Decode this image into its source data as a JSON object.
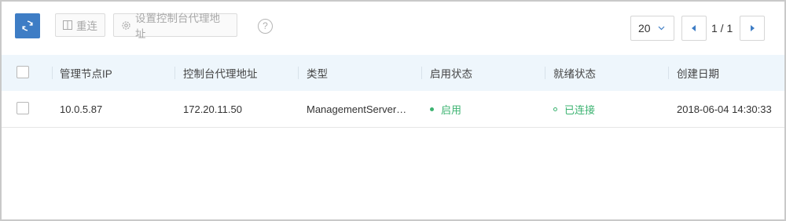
{
  "toolbar": {
    "refresh_icon": "refresh-icon",
    "reconnect_label": "重连",
    "set_proxy_label": "设置控制台代理地址",
    "help_glyph": "?"
  },
  "pagination": {
    "page_size": "20",
    "page_indicator": "1 / 1"
  },
  "table": {
    "columns": [
      "管理节点IP",
      "控制台代理地址",
      "类型",
      "启用状态",
      "就绪状态",
      "创建日期"
    ],
    "rows": [
      {
        "ip": "10.0.5.87",
        "proxy": "172.20.11.50",
        "type": "ManagementServer…",
        "enable_state": "启用",
        "ready_state": "已连接",
        "created": "2018-06-04 14:30:33"
      }
    ]
  },
  "colors": {
    "primary": "#3e7dc5",
    "header_bg": "#eef6fc",
    "status_green": "#3cb371"
  }
}
